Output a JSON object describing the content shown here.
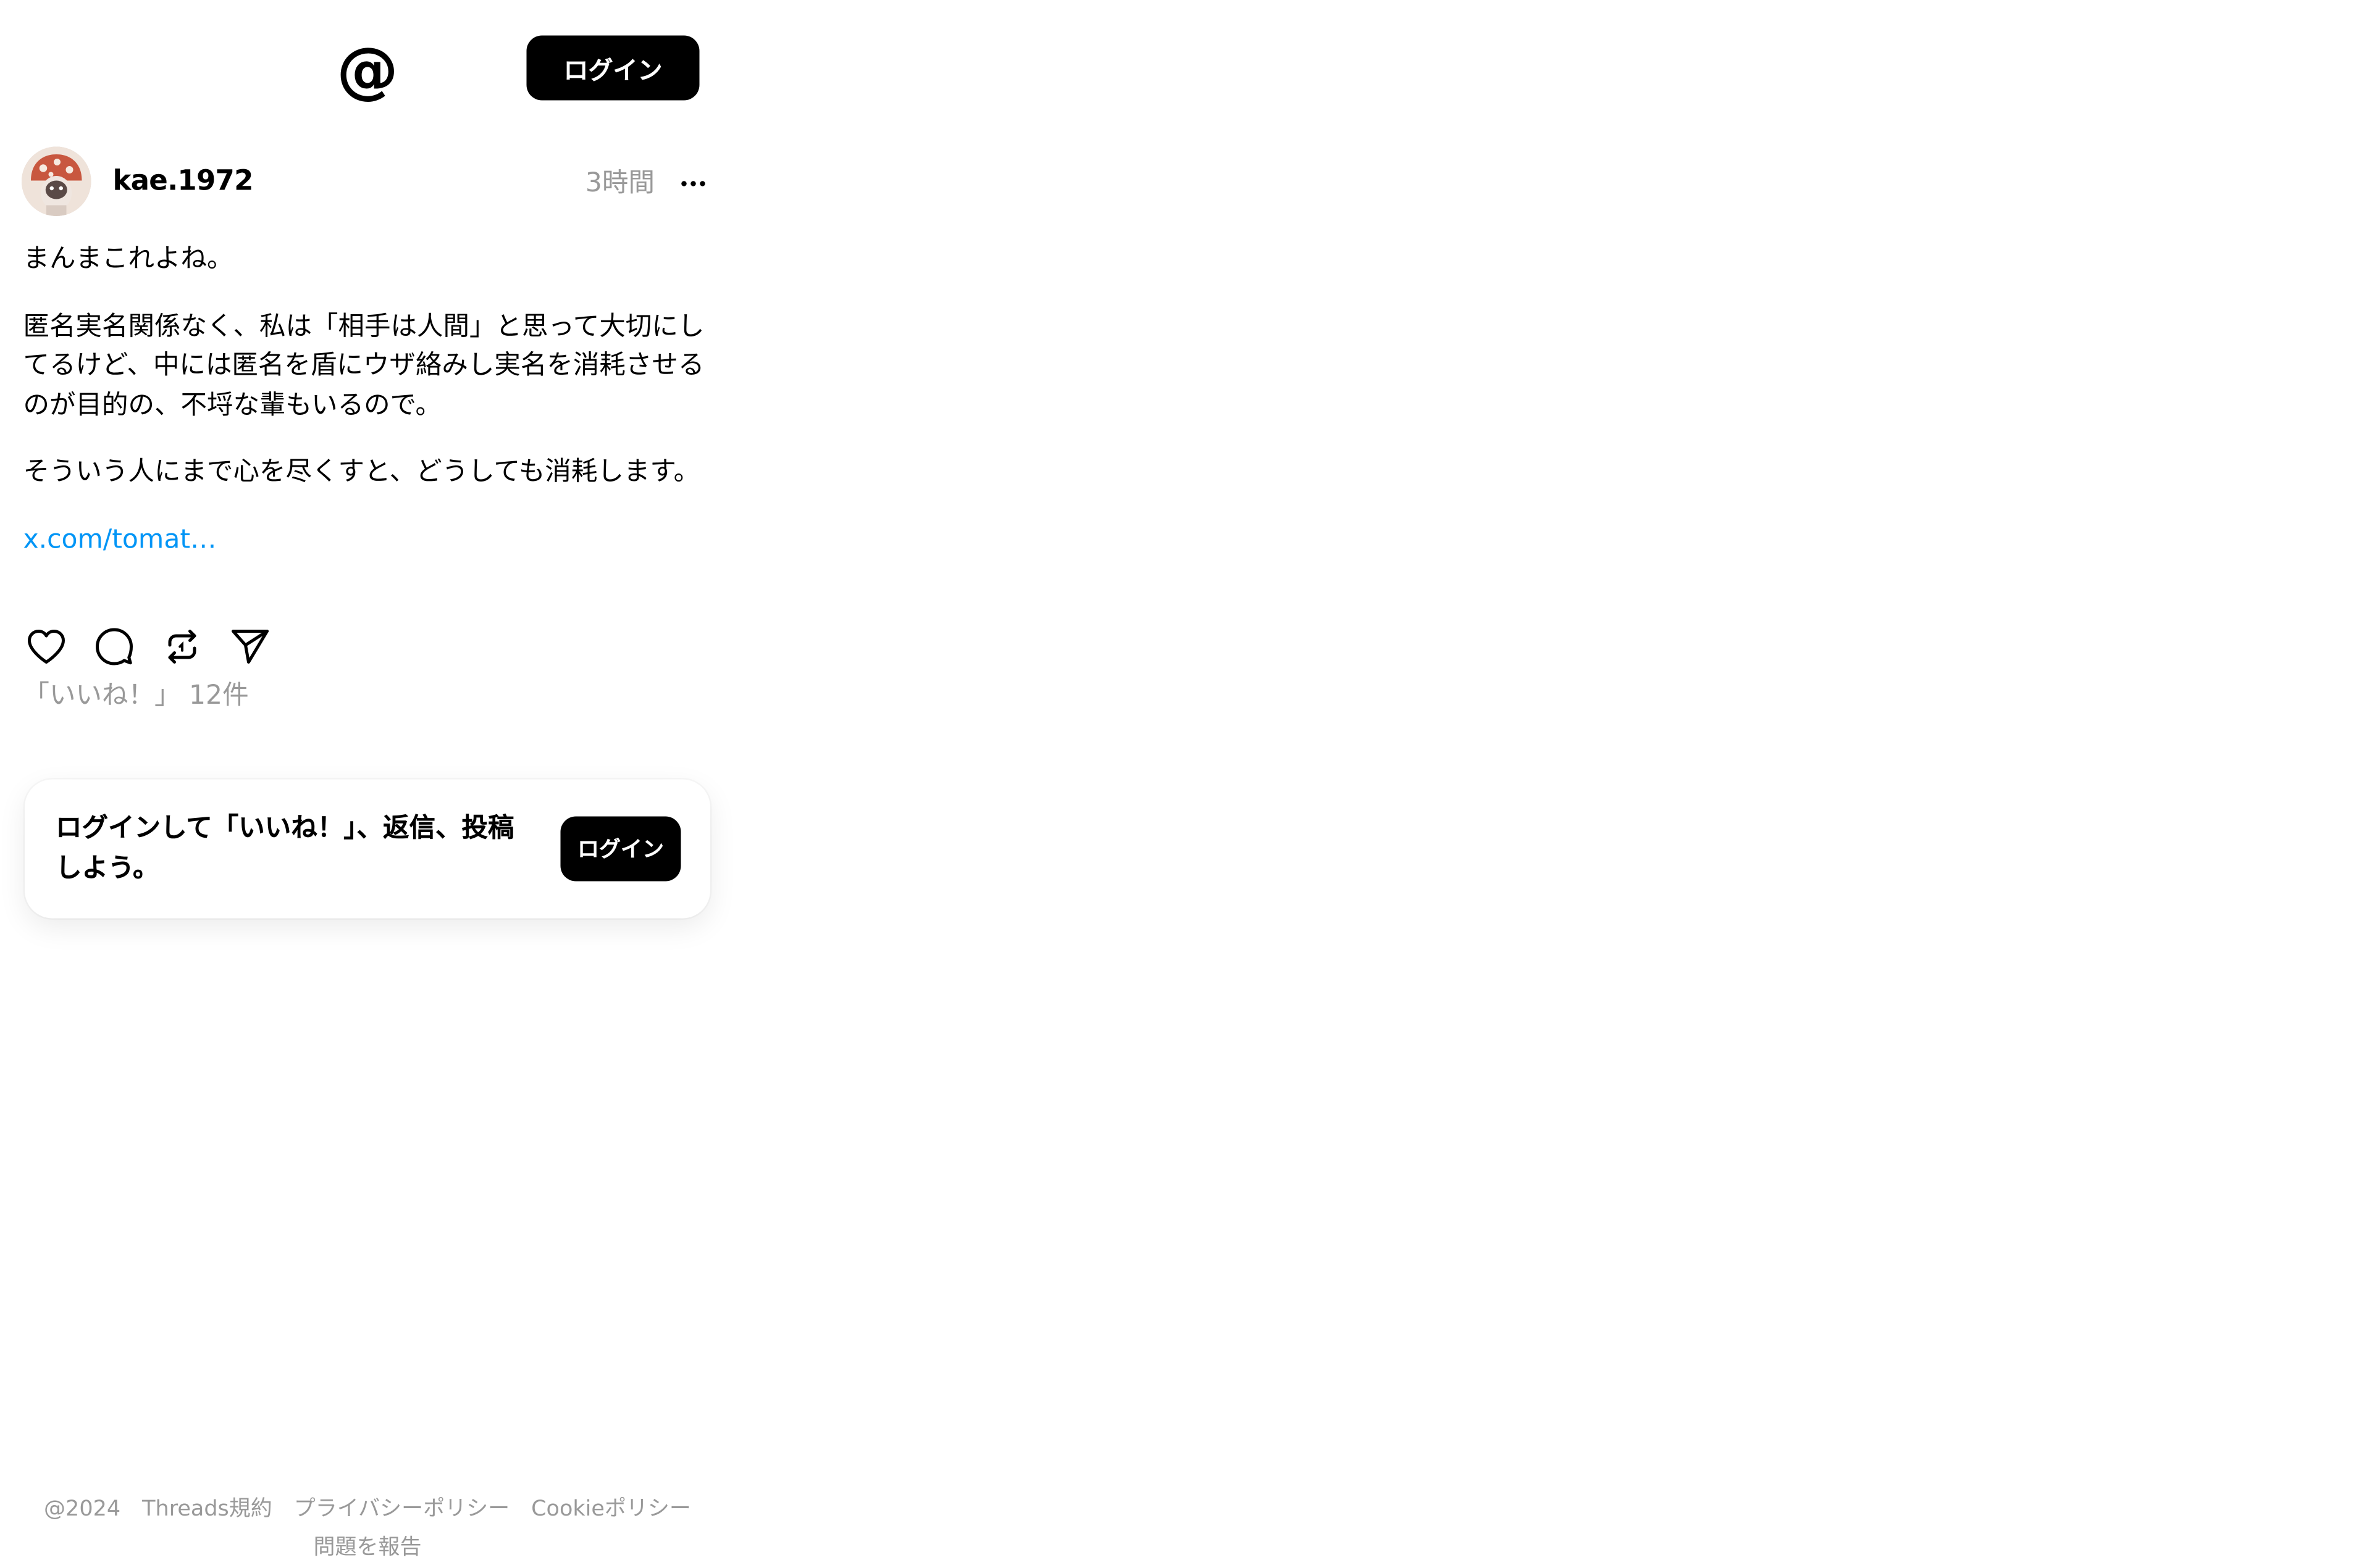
{
  "header": {
    "logo_glyph": "@",
    "login_label": "ログイン"
  },
  "post": {
    "username": "kae.1972",
    "time": "3時間",
    "more_glyph": "···",
    "paragraphs": [
      "まんまこれよね。",
      "匿名実名関係なく、私は「相手は人間」と思って大切にしてるけど、中には匿名を盾にウザ絡みし実名を消耗させるのが目的の、不埒な輩もいるので。",
      "そういう人にまで心を尽くすと、どうしても消耗します。"
    ],
    "link": "x.com/tomat…",
    "likes": "「いいね！」 12件"
  },
  "actions": {
    "like_icon": "heart-icon",
    "reply_icon": "comment-icon",
    "repost_icon": "repost-icon",
    "share_icon": "send-icon"
  },
  "login_card": {
    "text": "ログインして「いいね！」、返信、投稿しよう。",
    "button_label": "ログイン"
  },
  "footer": {
    "copyright": "@2024",
    "terms": "Threads規約",
    "privacy": "プライバシーポリシー",
    "cookie": "Cookieポリシー",
    "report": "問題を報告"
  },
  "colors": {
    "accent_link": "#0095f6",
    "muted_text": "#999999",
    "button_bg": "#000000"
  }
}
